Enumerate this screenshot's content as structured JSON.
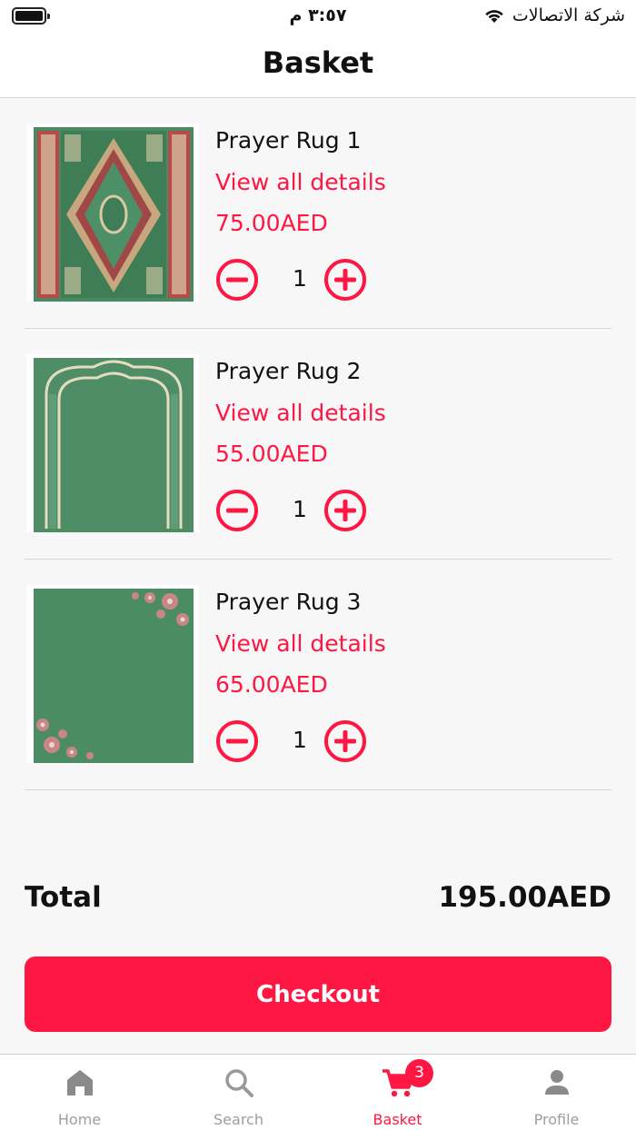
{
  "status_bar": {
    "time": "٣:٥٧ م",
    "carrier": "شركة الاتصالات"
  },
  "header": {
    "title": "Basket"
  },
  "items": [
    {
      "name": "Prayer Rug 1",
      "details_link": "View all details",
      "price": "75.00AED",
      "quantity": "1",
      "image": "green ornate prayer rug with medallion"
    },
    {
      "name": "Prayer Rug 2",
      "details_link": "View all details",
      "price": "55.00AED",
      "quantity": "1",
      "image": "green prayer rug with arch border"
    },
    {
      "name": "Prayer Rug 3",
      "details_link": "View all details",
      "price": "65.00AED",
      "quantity": "1",
      "image": "green prayer rug with floral corners"
    }
  ],
  "summary": {
    "total_label": "Total",
    "total_value": "195.00AED"
  },
  "checkout_label": "Checkout",
  "tabs": [
    {
      "label": "Home",
      "icon": "home-icon",
      "active": false
    },
    {
      "label": "Search",
      "icon": "search-icon",
      "active": false
    },
    {
      "label": "Basket",
      "icon": "cart-icon",
      "active": true,
      "badge": "3"
    },
    {
      "label": "Profile",
      "icon": "person-icon",
      "active": false
    }
  ],
  "colors": {
    "accent": "#ff1744",
    "tab_inactive": "#9e9e9e",
    "rug_green": "#4a8a62"
  }
}
